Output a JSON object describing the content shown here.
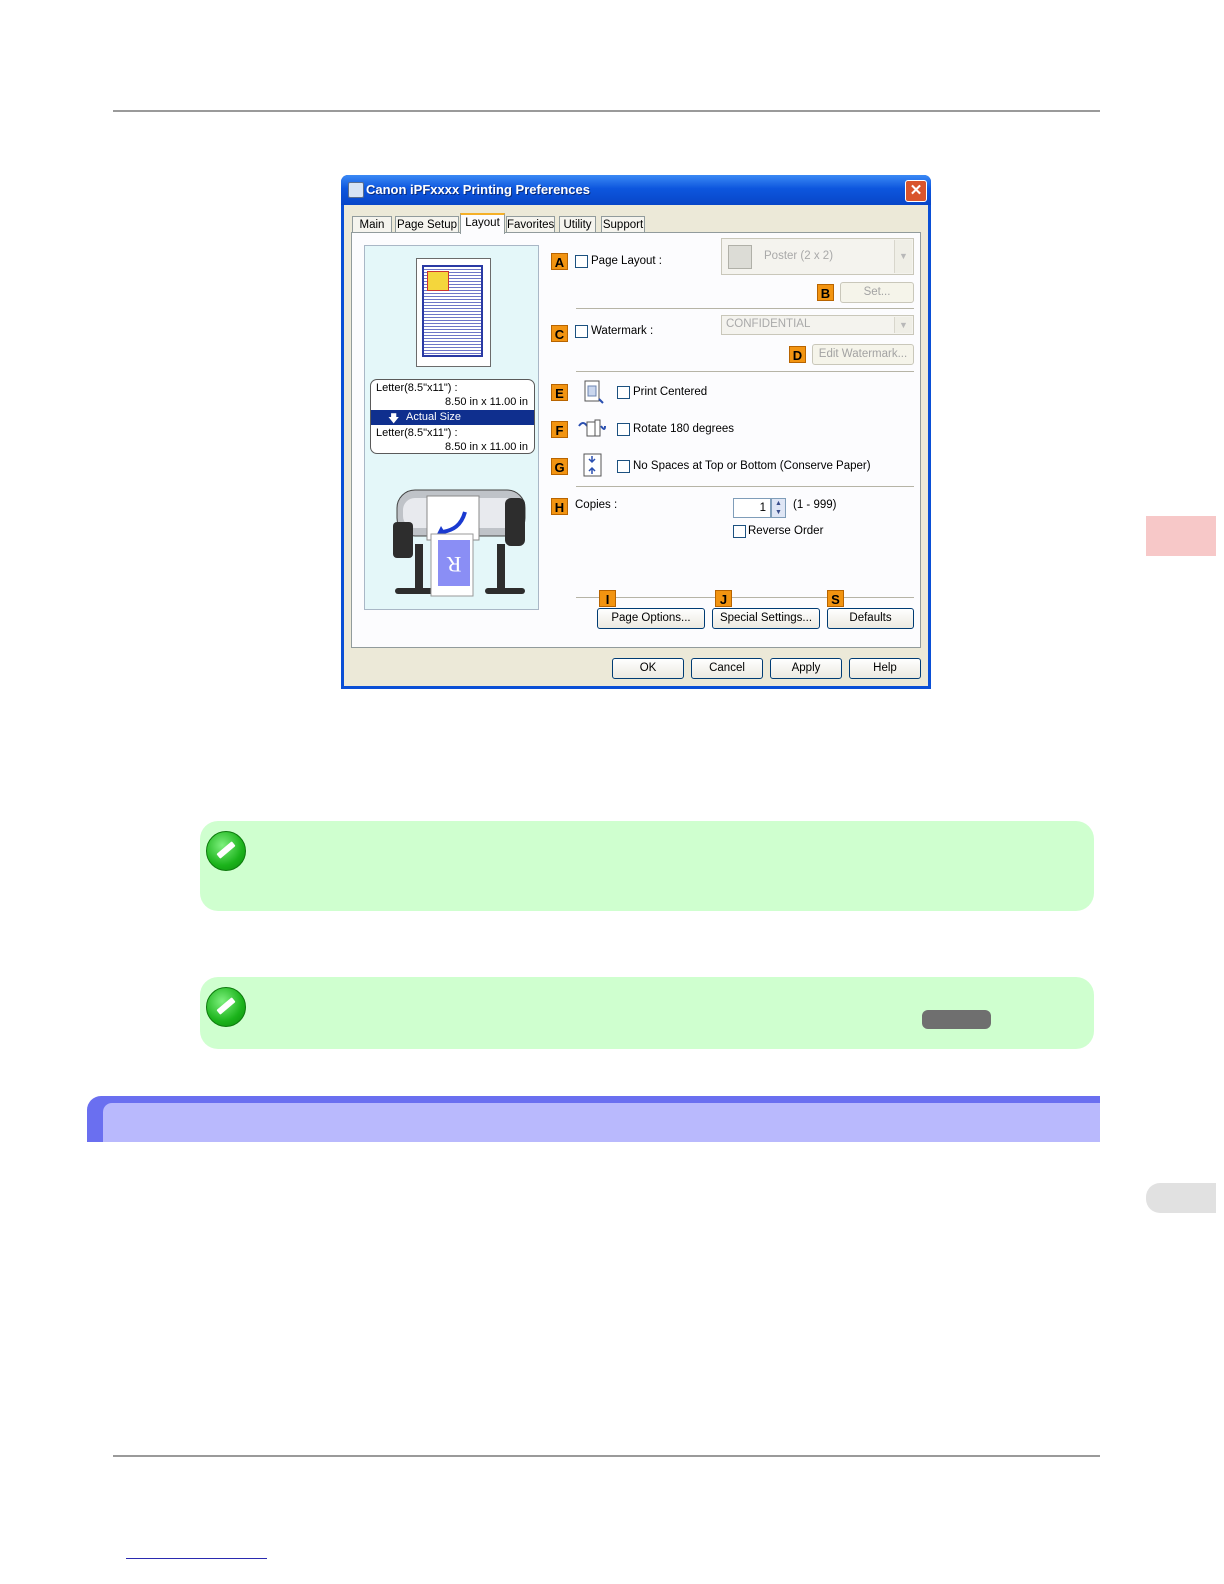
{
  "dialog": {
    "title": "Canon iPFxxxx Printing Preferences",
    "close_symbol": "✕",
    "tabs": [
      "Main",
      "Page Setup",
      "Layout",
      "Favorites",
      "Utility",
      "Support"
    ],
    "active_tab": "Layout",
    "preview": {
      "media_top_label": "Letter(8.5\"x11\") :",
      "media_top_size": "8.50 in x 11.00 in",
      "scale_label": "Actual Size",
      "media_bottom_label": "Letter(8.5\"x11\") :",
      "media_bottom_size": "8.50 in x 11.00 in"
    },
    "settings": {
      "page_layout": {
        "badge": "A",
        "label": "Page Layout :",
        "checked": false,
        "combo_value": "Poster (2 x 2)",
        "combo_icon": "poster-layout-icon",
        "enabled": false
      },
      "set_button": {
        "badge": "B",
        "label": "Set...",
        "enabled": false
      },
      "watermark": {
        "badge": "C",
        "label": "Watermark :",
        "checked": false,
        "combo_value": "CONFIDENTIAL",
        "enabled": false
      },
      "edit_watermark_button": {
        "badge": "D",
        "label": "Edit Watermark...",
        "enabled": false
      },
      "print_centered": {
        "badge": "E",
        "label": "Print Centered",
        "checked": false,
        "icon": "print-centered-icon"
      },
      "rotate_180": {
        "badge": "F",
        "label": "Rotate 180 degrees",
        "checked": false,
        "icon": "rotate-icon"
      },
      "no_spaces": {
        "badge": "G",
        "label": "No Spaces at Top or Bottom (Conserve Paper)",
        "checked": false,
        "icon": "conserve-paper-icon"
      },
      "copies": {
        "badge": "H",
        "label": "Copies :",
        "value": "1",
        "range": "(1 - 999)"
      },
      "reverse_order": {
        "label": "Reverse Order",
        "checked": false
      }
    },
    "bottom_buttons": [
      {
        "badge": "I",
        "label": "Page Options..."
      },
      {
        "badge": "J",
        "label": "Special Settings..."
      },
      {
        "badge": "S",
        "label": "Defaults"
      }
    ],
    "footer_buttons": [
      "OK",
      "Cancel",
      "Apply",
      "Help"
    ]
  },
  "colors": {
    "titlebar": "#0d56de",
    "badge": "#f29411",
    "note_background": "#cfffcf",
    "section_bar": "#6a6ff0",
    "section_bar_inner": "#b9b9fd",
    "side_tab_pink": "#f7c8c8",
    "side_tab_grey": "#e1e1e1"
  },
  "notes": [
    {
      "icon": "note-pencil-icon"
    },
    {
      "icon": "note-pencil-icon"
    }
  ]
}
